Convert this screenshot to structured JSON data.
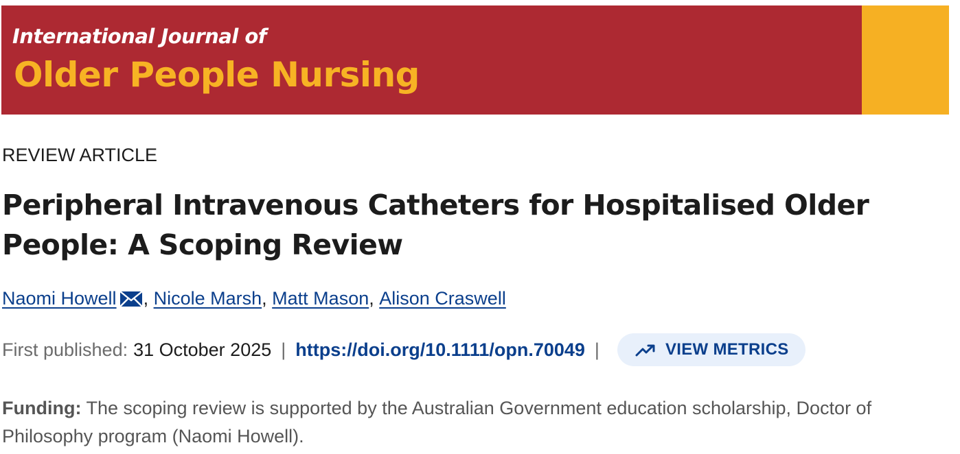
{
  "journal": {
    "line1": "International Journal of",
    "line2": "Older People Nursing"
  },
  "article": {
    "type": "REVIEW ARTICLE",
    "title": "Peripheral Intravenous Catheters for Hospitalised Older People: A Scoping Review"
  },
  "authors": [
    {
      "name": "Naomi Howell",
      "has_email_icon": true
    },
    {
      "name": "Nicole Marsh"
    },
    {
      "name": "Matt Mason"
    },
    {
      "name": "Alison Craswell"
    }
  ],
  "author_separator": ",",
  "meta": {
    "published_label": "First published:",
    "published_date": "31 October 2025",
    "separator": "|",
    "doi": "https://doi.org/10.1111/opn.70049",
    "metrics_label": "VIEW METRICS",
    "metrics_icon": "trending-up-icon"
  },
  "funding": {
    "label": "Funding:",
    "text": "The scoping review is supported by the Australian Government education scholarship, Doctor of Philosophy program (Naomi Howell)."
  },
  "colors": {
    "banner_red": "#ad2932",
    "banner_yellow": "#f6b023",
    "link_blue": "#0b3f8c",
    "metrics_bg": "#e8f0fb"
  }
}
